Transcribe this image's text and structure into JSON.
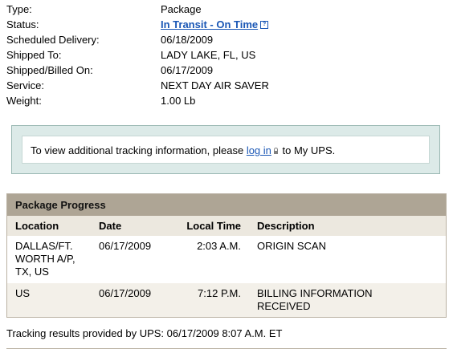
{
  "details": {
    "rows": [
      {
        "label": "Type:",
        "value": "Package"
      },
      {
        "label": "Status:",
        "value": "In Transit - On Time"
      },
      {
        "label": "Scheduled Delivery:",
        "value": "06/18/2009"
      },
      {
        "label": "Shipped To:",
        "value": "LADY LAKE, FL, US"
      },
      {
        "label": "Shipped/Billed On:",
        "value": "06/17/2009"
      },
      {
        "label": "Service:",
        "value": "NEXT DAY AIR SAVER"
      },
      {
        "label": "Weight:",
        "value": "1.00 Lb"
      }
    ],
    "help_glyph": "?"
  },
  "notice": {
    "prefix": "To view additional tracking information, please ",
    "link": "log in",
    "suffix": " to My UPS."
  },
  "progress": {
    "title": "Package Progress",
    "columns": [
      "Location",
      "Date",
      "Local Time",
      "Description"
    ],
    "rows": [
      {
        "location": "DALLAS/FT.\nWORTH A/P,\nTX,  US",
        "date": "06/17/2009",
        "time": "2:03 A.M.",
        "description": "ORIGIN SCAN"
      },
      {
        "location": "US",
        "date": "06/17/2009",
        "time": "7:12 P.M.",
        "description": "BILLING INFORMATION\nRECEIVED"
      }
    ]
  },
  "footer": {
    "text": "Tracking results provided by UPS:  06/17/2009 8:07 A.M.  ET"
  },
  "colors": {
    "link": "#1a57b5",
    "progress_title_bg": "#aea595",
    "progress_header_bg": "#ece8df",
    "notice_bg": "#dceae8"
  }
}
